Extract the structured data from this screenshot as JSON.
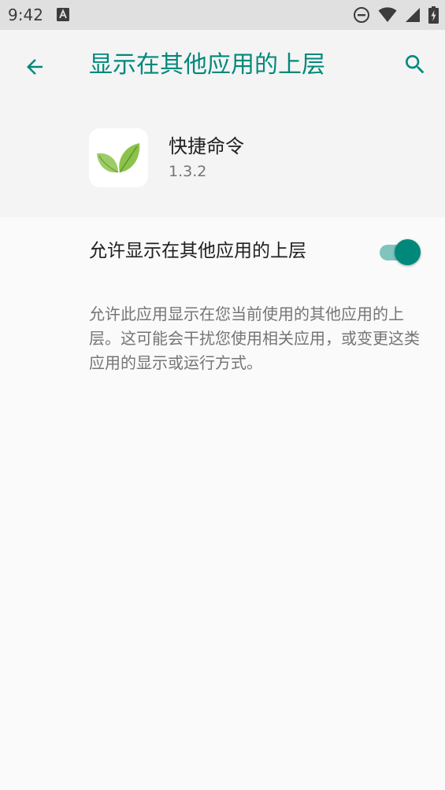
{
  "status_bar": {
    "time": "9:42",
    "left_icons": [
      "a-notification-icon"
    ],
    "right_icons": [
      "do-not-disturb-icon",
      "wifi-icon",
      "cellular-signal-icon",
      "battery-charging-icon"
    ]
  },
  "toolbar": {
    "title": "显示在其他应用的上层",
    "accent_color": "#00897b",
    "back_icon": "back-arrow-icon",
    "search_icon": "search-icon"
  },
  "app": {
    "name": "快捷命令",
    "version": "1.3.2",
    "icon": "leaf-icon"
  },
  "setting": {
    "label": "允许显示在其他应用的上层",
    "enabled": true,
    "description": "允许此应用显示在您当前使用的其他应用的上层。这可能会干扰您使用相关应用，或变更这类应用的显示或运行方式。"
  }
}
